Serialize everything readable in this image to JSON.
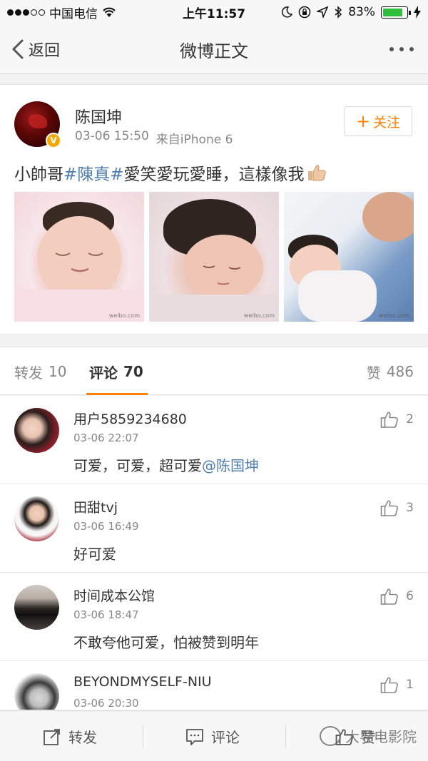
{
  "status_bar": {
    "carrier": "中国电信",
    "time": "上午11:57",
    "battery": "83%",
    "battery_level": 0.83,
    "icons": [
      "signal-dots-icon",
      "wifi-icon",
      "moon-icon",
      "lock-rotation-icon",
      "location-arrow-icon",
      "bluetooth-icon",
      "battery-icon",
      "charging-icon"
    ]
  },
  "nav": {
    "back_label": "返回",
    "title": "微博正文",
    "more_icon": "more-icon"
  },
  "post": {
    "author": "陈国坤",
    "verified_icon": "verified-v-icon",
    "date": "03-06 15:50",
    "source": "来自iPhone 6",
    "follow_label": "关注",
    "text_before": "小帥哥",
    "hashtag": "#陳真#",
    "text_after": " 愛笑愛玩愛睡，這樣像我",
    "emoji": "thumbs-up-emoji",
    "photos": [
      "baby-photo-1",
      "baby-photo-2",
      "baby-photo-3"
    ]
  },
  "tabs": {
    "repost_label": "转发",
    "repost_count": "10",
    "comment_label": "评论",
    "comment_count": "70",
    "like_label": "赞",
    "like_count": "486"
  },
  "comments": [
    {
      "name": "用户5859234680",
      "time": "03-06 22:07",
      "text": "可爱，可爱，超可爱",
      "mention": "@陈国坤",
      "likes": "2"
    },
    {
      "name": "田甜tvj",
      "time": "03-06 16:49",
      "text": "好可爱",
      "mention": "",
      "likes": "3"
    },
    {
      "name": "时间成本公馆",
      "time": "03-06 18:47",
      "text": "不敢夸他可爱，怕被赞到明年",
      "mention": "",
      "likes": "6"
    },
    {
      "name": "BEYONDMYSELF-NIU",
      "time": "03-06 20:30",
      "text": "",
      "mention": "",
      "likes": "1"
    }
  ],
  "bottom_bar": {
    "repost_label": "转发",
    "comment_label": "评论",
    "like_label": "赞"
  },
  "watermark": "大导电影院"
}
